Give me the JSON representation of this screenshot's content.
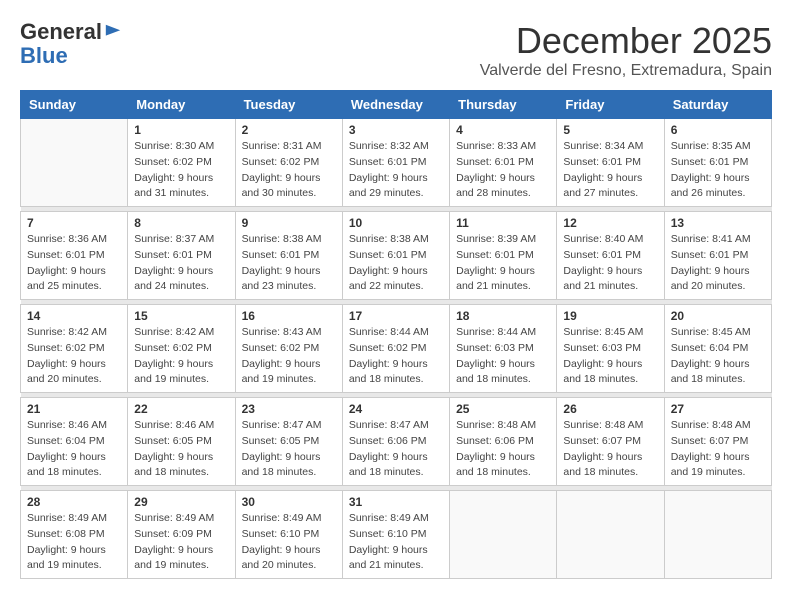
{
  "header": {
    "logo_general": "General",
    "logo_blue": "Blue",
    "month_title": "December 2025",
    "location": "Valverde del Fresno, Extremadura, Spain"
  },
  "columns": [
    "Sunday",
    "Monday",
    "Tuesday",
    "Wednesday",
    "Thursday",
    "Friday",
    "Saturday"
  ],
  "weeks": [
    [
      {
        "day": "",
        "info": ""
      },
      {
        "day": "1",
        "info": "Sunrise: 8:30 AM\nSunset: 6:02 PM\nDaylight: 9 hours\nand 31 minutes."
      },
      {
        "day": "2",
        "info": "Sunrise: 8:31 AM\nSunset: 6:02 PM\nDaylight: 9 hours\nand 30 minutes."
      },
      {
        "day": "3",
        "info": "Sunrise: 8:32 AM\nSunset: 6:01 PM\nDaylight: 9 hours\nand 29 minutes."
      },
      {
        "day": "4",
        "info": "Sunrise: 8:33 AM\nSunset: 6:01 PM\nDaylight: 9 hours\nand 28 minutes."
      },
      {
        "day": "5",
        "info": "Sunrise: 8:34 AM\nSunset: 6:01 PM\nDaylight: 9 hours\nand 27 minutes."
      },
      {
        "day": "6",
        "info": "Sunrise: 8:35 AM\nSunset: 6:01 PM\nDaylight: 9 hours\nand 26 minutes."
      }
    ],
    [
      {
        "day": "7",
        "info": "Sunrise: 8:36 AM\nSunset: 6:01 PM\nDaylight: 9 hours\nand 25 minutes."
      },
      {
        "day": "8",
        "info": "Sunrise: 8:37 AM\nSunset: 6:01 PM\nDaylight: 9 hours\nand 24 minutes."
      },
      {
        "day": "9",
        "info": "Sunrise: 8:38 AM\nSunset: 6:01 PM\nDaylight: 9 hours\nand 23 minutes."
      },
      {
        "day": "10",
        "info": "Sunrise: 8:38 AM\nSunset: 6:01 PM\nDaylight: 9 hours\nand 22 minutes."
      },
      {
        "day": "11",
        "info": "Sunrise: 8:39 AM\nSunset: 6:01 PM\nDaylight: 9 hours\nand 21 minutes."
      },
      {
        "day": "12",
        "info": "Sunrise: 8:40 AM\nSunset: 6:01 PM\nDaylight: 9 hours\nand 21 minutes."
      },
      {
        "day": "13",
        "info": "Sunrise: 8:41 AM\nSunset: 6:01 PM\nDaylight: 9 hours\nand 20 minutes."
      }
    ],
    [
      {
        "day": "14",
        "info": "Sunrise: 8:42 AM\nSunset: 6:02 PM\nDaylight: 9 hours\nand 20 minutes."
      },
      {
        "day": "15",
        "info": "Sunrise: 8:42 AM\nSunset: 6:02 PM\nDaylight: 9 hours\nand 19 minutes."
      },
      {
        "day": "16",
        "info": "Sunrise: 8:43 AM\nSunset: 6:02 PM\nDaylight: 9 hours\nand 19 minutes."
      },
      {
        "day": "17",
        "info": "Sunrise: 8:44 AM\nSunset: 6:02 PM\nDaylight: 9 hours\nand 18 minutes."
      },
      {
        "day": "18",
        "info": "Sunrise: 8:44 AM\nSunset: 6:03 PM\nDaylight: 9 hours\nand 18 minutes."
      },
      {
        "day": "19",
        "info": "Sunrise: 8:45 AM\nSunset: 6:03 PM\nDaylight: 9 hours\nand 18 minutes."
      },
      {
        "day": "20",
        "info": "Sunrise: 8:45 AM\nSunset: 6:04 PM\nDaylight: 9 hours\nand 18 minutes."
      }
    ],
    [
      {
        "day": "21",
        "info": "Sunrise: 8:46 AM\nSunset: 6:04 PM\nDaylight: 9 hours\nand 18 minutes."
      },
      {
        "day": "22",
        "info": "Sunrise: 8:46 AM\nSunset: 6:05 PM\nDaylight: 9 hours\nand 18 minutes."
      },
      {
        "day": "23",
        "info": "Sunrise: 8:47 AM\nSunset: 6:05 PM\nDaylight: 9 hours\nand 18 minutes."
      },
      {
        "day": "24",
        "info": "Sunrise: 8:47 AM\nSunset: 6:06 PM\nDaylight: 9 hours\nand 18 minutes."
      },
      {
        "day": "25",
        "info": "Sunrise: 8:48 AM\nSunset: 6:06 PM\nDaylight: 9 hours\nand 18 minutes."
      },
      {
        "day": "26",
        "info": "Sunrise: 8:48 AM\nSunset: 6:07 PM\nDaylight: 9 hours\nand 18 minutes."
      },
      {
        "day": "27",
        "info": "Sunrise: 8:48 AM\nSunset: 6:07 PM\nDaylight: 9 hours\nand 19 minutes."
      }
    ],
    [
      {
        "day": "28",
        "info": "Sunrise: 8:49 AM\nSunset: 6:08 PM\nDaylight: 9 hours\nand 19 minutes."
      },
      {
        "day": "29",
        "info": "Sunrise: 8:49 AM\nSunset: 6:09 PM\nDaylight: 9 hours\nand 19 minutes."
      },
      {
        "day": "30",
        "info": "Sunrise: 8:49 AM\nSunset: 6:10 PM\nDaylight: 9 hours\nand 20 minutes."
      },
      {
        "day": "31",
        "info": "Sunrise: 8:49 AM\nSunset: 6:10 PM\nDaylight: 9 hours\nand 21 minutes."
      },
      {
        "day": "",
        "info": ""
      },
      {
        "day": "",
        "info": ""
      },
      {
        "day": "",
        "info": ""
      }
    ]
  ]
}
